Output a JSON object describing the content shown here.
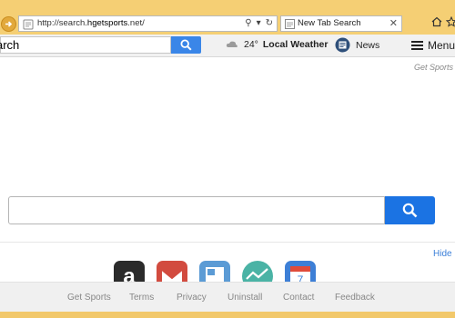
{
  "browser": {
    "url_prefix": "http://search.",
    "url_domain": "hgetsports",
    "url_suffix": ".net/",
    "tab_title": "New Tab Search"
  },
  "toolbar": {
    "search_value": "arch",
    "weather_temp": "24°",
    "weather_label": "Local Weather",
    "news_label": "News",
    "menu_label": "Menu"
  },
  "page": {
    "brand": "Get Sports",
    "hide_label": "Hide"
  },
  "tiles": [
    {
      "name": "amazon",
      "glyph": "a",
      "color": "#2b2b2b"
    },
    {
      "name": "gmail",
      "glyph": "M",
      "color": "#d24b3f"
    },
    {
      "name": "news-app",
      "glyph": "▤",
      "color": "#5b9bd5"
    },
    {
      "name": "stocks-app",
      "glyph": "∿",
      "color": "#4ab3a5"
    },
    {
      "name": "calendar",
      "glyph": "7",
      "color": "#3d7fd6"
    }
  ],
  "footer": {
    "get_sports": "Get Sports",
    "terms": "Terms",
    "privacy": "Privacy",
    "uninstall": "Uninstall",
    "contact": "Contact",
    "feedback": "Feedback"
  },
  "colors": {
    "chrome": "#f5cf74",
    "accent_blue": "#1b73e3",
    "link_blue": "#3b7fd8"
  }
}
